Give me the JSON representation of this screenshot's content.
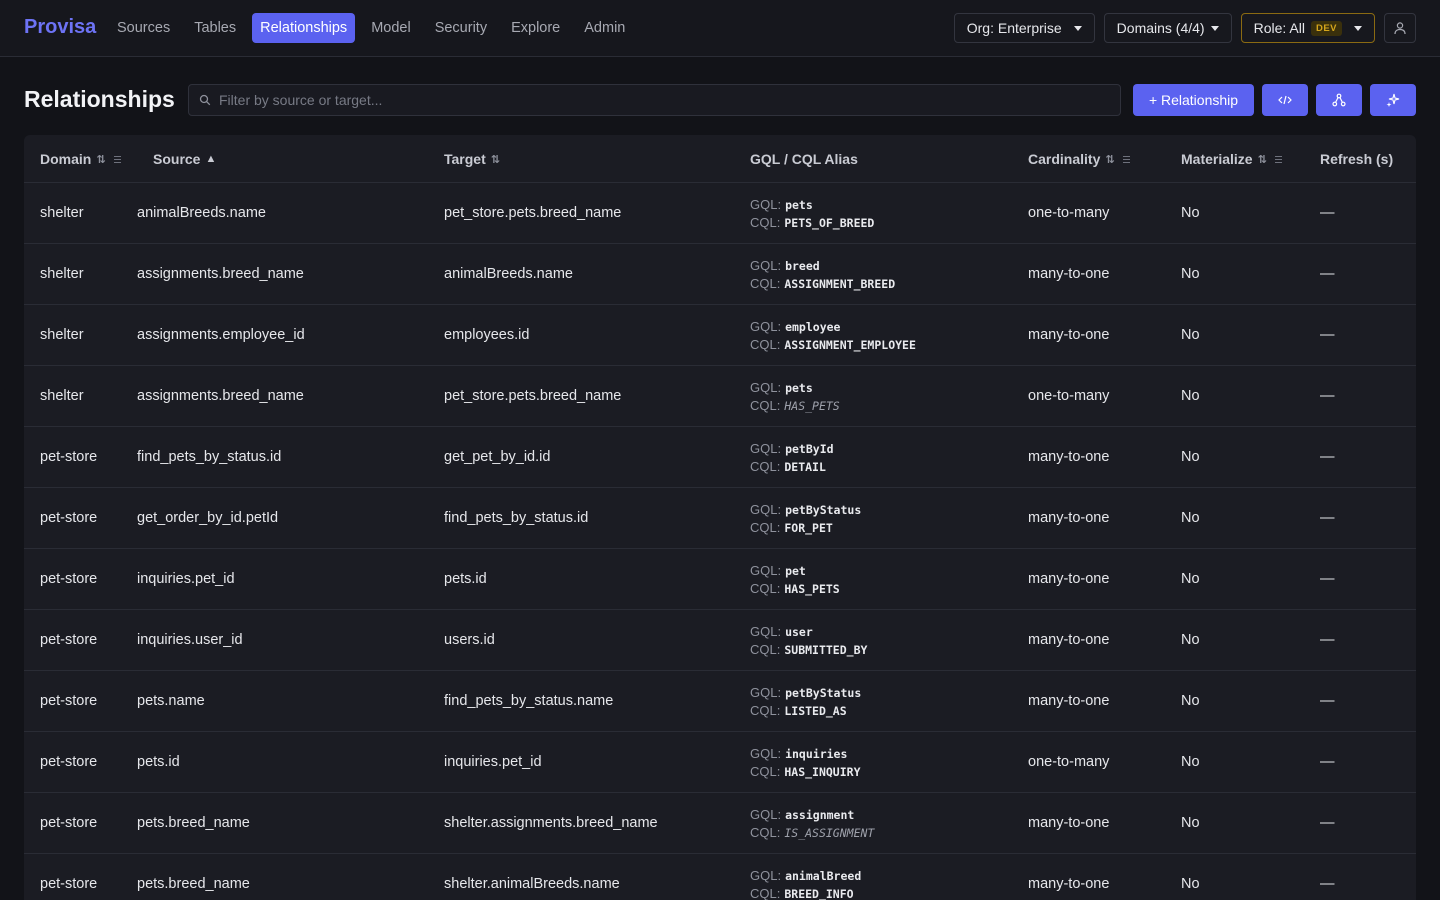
{
  "nav": {
    "brand": "Provisa",
    "items": [
      {
        "label": "Sources"
      },
      {
        "label": "Tables"
      },
      {
        "label": "Relationships"
      },
      {
        "label": "Model"
      },
      {
        "label": "Security"
      },
      {
        "label": "Explore"
      },
      {
        "label": "Admin"
      }
    ],
    "active": "Relationships",
    "org_label": "Org: Enterprise",
    "domains_label": "Domains (4/4)",
    "role_label": "Role: All",
    "role_badge": "DEV"
  },
  "toolbar": {
    "title": "Relationships",
    "filter_placeholder": "Filter by source or target...",
    "add_label": "+ Relationship"
  },
  "table": {
    "columns": {
      "domain": "Domain",
      "source": "Source",
      "target": "Target",
      "alias": "GQL / CQL Alias",
      "cardinality": "Cardinality",
      "materialize": "Materialize",
      "refresh": "Refresh (s)"
    },
    "gql_prefix": "GQL:",
    "cql_prefix": "CQL:",
    "rows": [
      {
        "domain": "shelter",
        "source": "animalBreeds.name",
        "target": "pet_store.pets.breed_name",
        "gql": "pets",
        "cql": "PETS_OF_BREED",
        "cql_italic": false,
        "cardinality": "one-to-many",
        "materialize": "No",
        "refresh": "—"
      },
      {
        "domain": "shelter",
        "source": "assignments.breed_name",
        "target": "animalBreeds.name",
        "gql": "breed",
        "cql": "ASSIGNMENT_BREED",
        "cql_italic": false,
        "cardinality": "many-to-one",
        "materialize": "No",
        "refresh": "—"
      },
      {
        "domain": "shelter",
        "source": "assignments.employee_id",
        "target": "employees.id",
        "gql": "employee",
        "cql": "ASSIGNMENT_EMPLOYEE",
        "cql_italic": false,
        "cardinality": "many-to-one",
        "materialize": "No",
        "refresh": "—"
      },
      {
        "domain": "shelter",
        "source": "assignments.breed_name",
        "target": "pet_store.pets.breed_name",
        "gql": "pets",
        "cql": "HAS_PETS",
        "cql_italic": true,
        "cardinality": "one-to-many",
        "materialize": "No",
        "refresh": "—"
      },
      {
        "domain": "pet-store",
        "source": "find_pets_by_status.id",
        "target": "get_pet_by_id.id",
        "gql": "petById",
        "cql": "DETAIL",
        "cql_italic": false,
        "cardinality": "many-to-one",
        "materialize": "No",
        "refresh": "—"
      },
      {
        "domain": "pet-store",
        "source": "get_order_by_id.petId",
        "target": "find_pets_by_status.id",
        "gql": "petByStatus",
        "cql": "FOR_PET",
        "cql_italic": false,
        "cardinality": "many-to-one",
        "materialize": "No",
        "refresh": "—"
      },
      {
        "domain": "pet-store",
        "source": "inquiries.pet_id",
        "target": "pets.id",
        "gql": "pet",
        "cql": "HAS_PETS",
        "cql_italic": false,
        "cardinality": "many-to-one",
        "materialize": "No",
        "refresh": "—"
      },
      {
        "domain": "pet-store",
        "source": "inquiries.user_id",
        "target": "users.id",
        "gql": "user",
        "cql": "SUBMITTED_BY",
        "cql_italic": false,
        "cardinality": "many-to-one",
        "materialize": "No",
        "refresh": "—"
      },
      {
        "domain": "pet-store",
        "source": "pets.name",
        "target": "find_pets_by_status.name",
        "gql": "petByStatus",
        "cql": "LISTED_AS",
        "cql_italic": false,
        "cardinality": "many-to-one",
        "materialize": "No",
        "refresh": "—"
      },
      {
        "domain": "pet-store",
        "source": "pets.id",
        "target": "inquiries.pet_id",
        "gql": "inquiries",
        "cql": "HAS_INQUIRY",
        "cql_italic": false,
        "cardinality": "one-to-many",
        "materialize": "No",
        "refresh": "—"
      },
      {
        "domain": "pet-store",
        "source": "pets.breed_name",
        "target": "shelter.assignments.breed_name",
        "gql": "assignment",
        "cql": "IS_ASSIGNMENT",
        "cql_italic": true,
        "cardinality": "many-to-one",
        "materialize": "No",
        "refresh": "—"
      },
      {
        "domain": "pet-store",
        "source": "pets.breed_name",
        "target": "shelter.animalBreeds.name",
        "gql": "animalBreed",
        "cql": "BREED_INFO",
        "cql_italic": false,
        "cardinality": "many-to-one",
        "materialize": "No",
        "refresh": "—"
      }
    ]
  }
}
